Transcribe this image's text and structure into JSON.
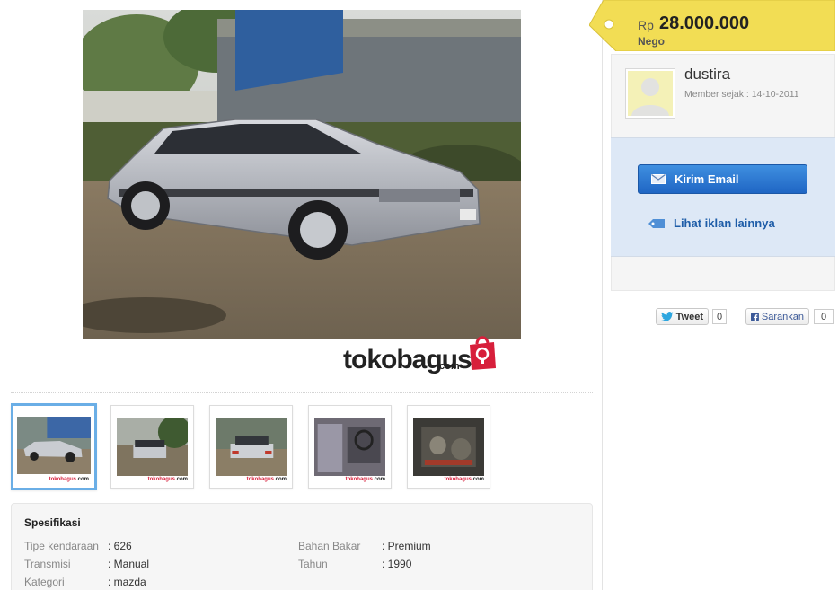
{
  "listing": {
    "main_image_alt": "Silver sedan parked on a dirt road",
    "logo": {
      "word_1": "toko",
      "word_2": "bagus",
      "suffix": ".com"
    },
    "thumbnails": [
      {
        "label": "photo-1"
      },
      {
        "label": "photo-2"
      },
      {
        "label": "photo-3"
      },
      {
        "label": "photo-4"
      },
      {
        "label": "photo-5"
      }
    ],
    "thumbnail_watermark": {
      "prefix": "tokobagus",
      "suffix": ".com"
    }
  },
  "specs": {
    "title": "Spesifikasi",
    "rows": [
      {
        "key": "Tipe kendaraan",
        "value": ": 626"
      },
      {
        "key": "Transmisi",
        "value": ": Manual"
      },
      {
        "key": "Kategori",
        "value": ": mazda"
      },
      {
        "key": "Bahan Bakar",
        "value": ": Premium"
      },
      {
        "key": "Tahun",
        "value": ": 1990"
      }
    ]
  },
  "price": {
    "currency": "Rp",
    "amount": "28.000.000",
    "note": "Nego"
  },
  "seller": {
    "name": "dustira",
    "member_since": "Member sejak : 14-10-2011",
    "email_button": "Kirim Email",
    "other_ads_link": "Lihat iklan lainnya"
  },
  "share": {
    "tweet_label": "Tweet",
    "tweet_count": "0",
    "fb_label": "Sarankan",
    "fb_count": "0"
  },
  "colors": {
    "price_tag": "#f2dd54",
    "email_button": "#2b78d4",
    "link": "#1e5da8",
    "panel_blue": "#dde8f6"
  }
}
